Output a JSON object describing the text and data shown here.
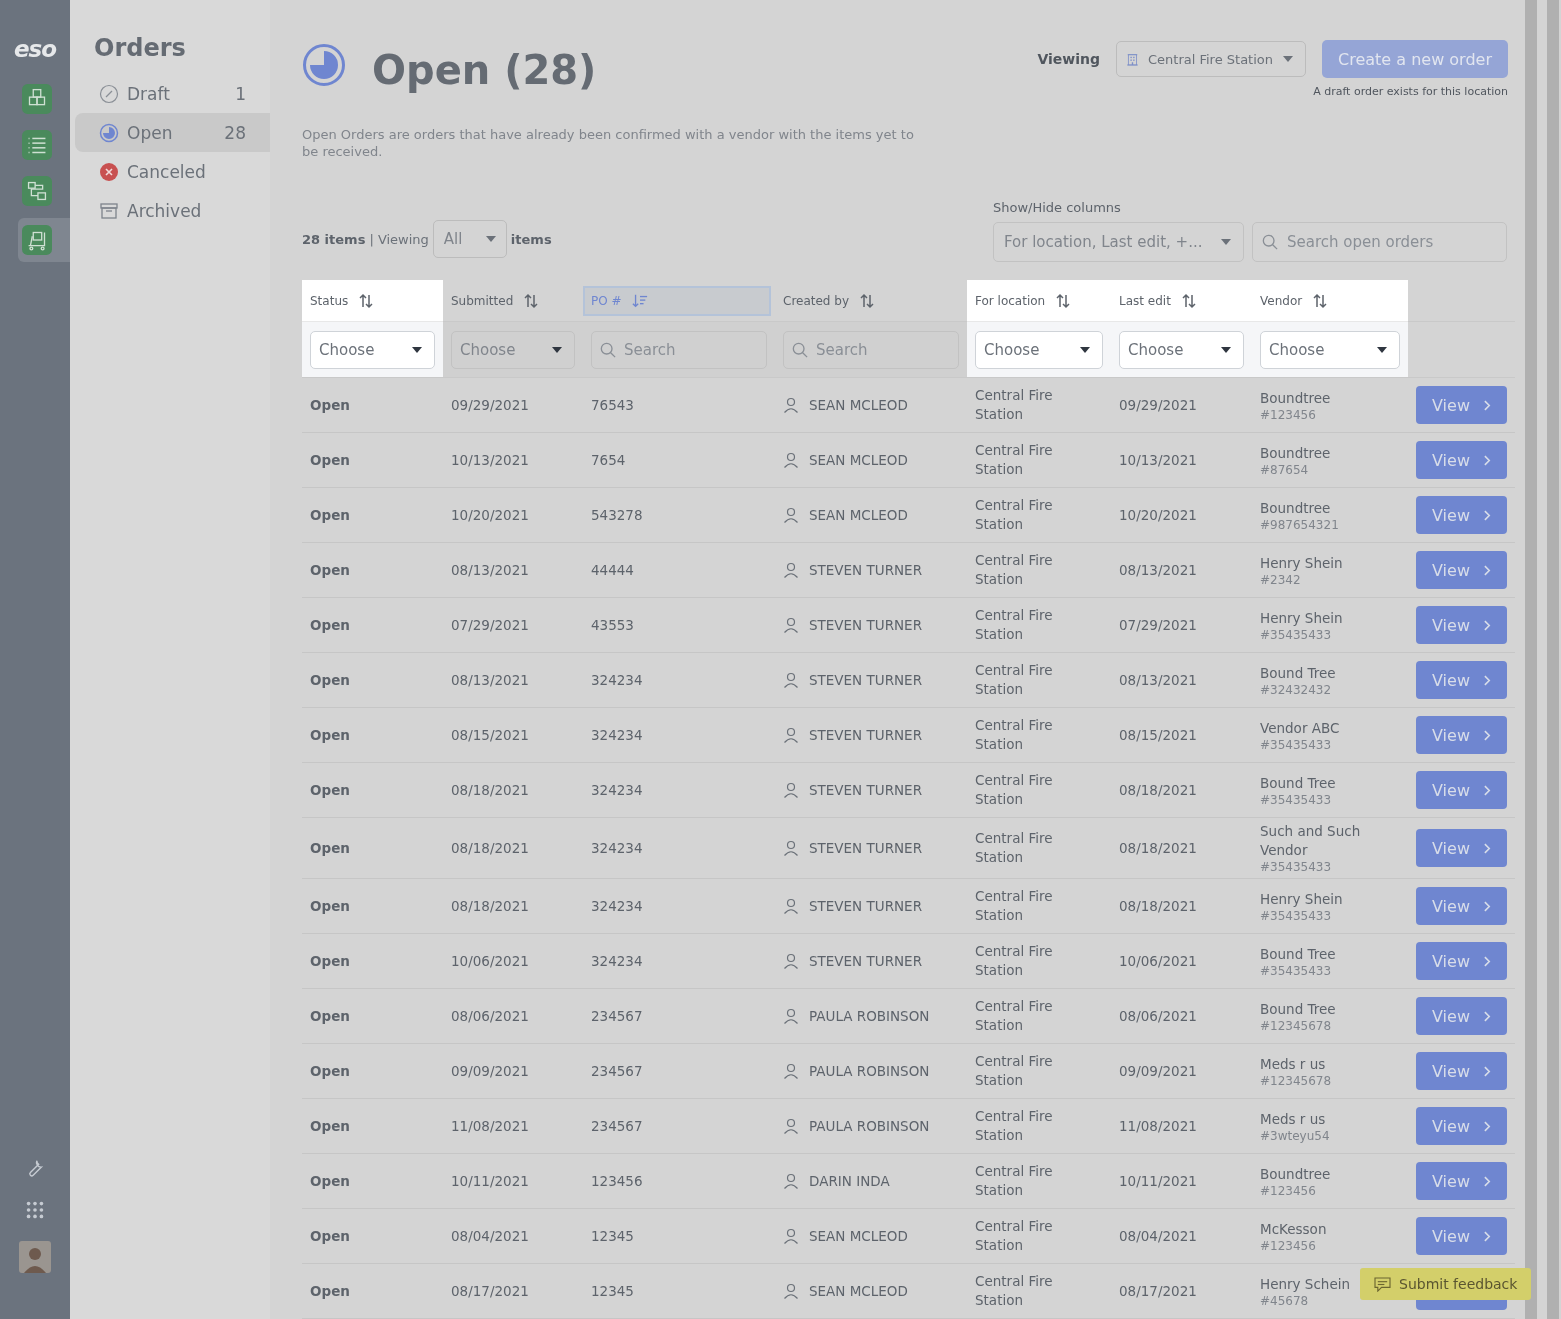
{
  "rail": {
    "logo": "eso",
    "items": [
      {
        "kind": "boxes",
        "selected": false
      },
      {
        "kind": "list",
        "selected": false
      },
      {
        "kind": "flow",
        "selected": false
      },
      {
        "kind": "cart",
        "selected": true
      }
    ]
  },
  "nav": {
    "title": "Orders",
    "items": [
      {
        "kind": "draft",
        "label": "Draft",
        "count": "1",
        "selected": false
      },
      {
        "kind": "open",
        "label": "Open",
        "count": "28",
        "selected": true
      },
      {
        "kind": "canceled",
        "label": "Canceled",
        "selected": false
      },
      {
        "kind": "archived",
        "label": "Archived",
        "selected": false
      }
    ]
  },
  "header": {
    "title": "Open (28)",
    "description": "Open Orders are orders that have already been confirmed with a vendor with the items yet to be received.",
    "viewing_label": "Viewing",
    "location": "Central Fire Station",
    "create_button": {
      "label": "Create a new order",
      "disabled": true
    },
    "note": "A draft order exists for this location"
  },
  "toolbar": {
    "count": "28 items",
    "viewing": "| Viewing",
    "page_size": "All",
    "suffix": "items",
    "columns_label": "Show/Hide columns",
    "columns_value": "For location, Last edit, +...",
    "search_placeholder": "Search open orders"
  },
  "columns": [
    {
      "label": "Status",
      "sorted": false,
      "highlighted": true,
      "filter": {
        "kind": "select",
        "placeholder": "Choose"
      }
    },
    {
      "label": "Submitted",
      "sorted": false,
      "highlighted": false,
      "filter": {
        "kind": "select",
        "placeholder": "Choose"
      }
    },
    {
      "label": "PO #",
      "sorted": true,
      "highlighted": false,
      "filter": {
        "kind": "search",
        "placeholder": "Search"
      }
    },
    {
      "label": "Created by",
      "sorted": false,
      "highlighted": false,
      "filter": {
        "kind": "search",
        "placeholder": "Search"
      }
    },
    {
      "label": "For location",
      "sorted": false,
      "highlighted": true,
      "filter": {
        "kind": "select",
        "placeholder": "Choose"
      }
    },
    {
      "label": "Last edit",
      "sorted": false,
      "highlighted": true,
      "filter": {
        "kind": "select",
        "placeholder": "Choose"
      }
    },
    {
      "label": "Vendor",
      "sorted": false,
      "highlighted": true,
      "filter": {
        "kind": "select",
        "placeholder": "Choose"
      }
    }
  ],
  "rows": [
    {
      "status": "Open",
      "submitted": "09/29/2021",
      "po": "76543",
      "created_by": "SEAN MCLEOD",
      "location": "Central Fire Station",
      "last_edit": "09/29/2021",
      "vendor": "Boundtree",
      "vendor_id": "#123456",
      "action": "View"
    },
    {
      "status": "Open",
      "submitted": "10/13/2021",
      "po": "7654",
      "created_by": "SEAN MCLEOD",
      "location": "Central Fire Station",
      "last_edit": "10/13/2021",
      "vendor": "Boundtree",
      "vendor_id": "#87654",
      "action": "View"
    },
    {
      "status": "Open",
      "submitted": "10/20/2021",
      "po": "543278",
      "created_by": "SEAN MCLEOD",
      "location": "Central Fire Station",
      "last_edit": "10/20/2021",
      "vendor": "Boundtree",
      "vendor_id": "#987654321",
      "action": "View"
    },
    {
      "status": "Open",
      "submitted": "08/13/2021",
      "po": "44444",
      "created_by": "STEVEN TURNER",
      "location": "Central Fire Station",
      "last_edit": "08/13/2021",
      "vendor": "Henry Shein",
      "vendor_id": "#2342",
      "action": "View"
    },
    {
      "status": "Open",
      "submitted": "07/29/2021",
      "po": "43553",
      "created_by": "STEVEN TURNER",
      "location": "Central Fire Station",
      "last_edit": "07/29/2021",
      "vendor": "Henry Shein",
      "vendor_id": "#35435433",
      "action": "View"
    },
    {
      "status": "Open",
      "submitted": "08/13/2021",
      "po": "324234",
      "created_by": "STEVEN TURNER",
      "location": "Central Fire Station",
      "last_edit": "08/13/2021",
      "vendor": "Bound Tree",
      "vendor_id": "#32432432",
      "action": "View"
    },
    {
      "status": "Open",
      "submitted": "08/15/2021",
      "po": "324234",
      "created_by": "STEVEN TURNER",
      "location": "Central Fire Station",
      "last_edit": "08/15/2021",
      "vendor": "Vendor ABC",
      "vendor_id": "#35435433",
      "action": "View"
    },
    {
      "status": "Open",
      "submitted": "08/18/2021",
      "po": "324234",
      "created_by": "STEVEN TURNER",
      "location": "Central Fire Station",
      "last_edit": "08/18/2021",
      "vendor": "Bound Tree",
      "vendor_id": "#35435433",
      "action": "View"
    },
    {
      "status": "Open",
      "submitted": "08/18/2021",
      "po": "324234",
      "created_by": "STEVEN TURNER",
      "location": "Central Fire Station",
      "last_edit": "08/18/2021",
      "vendor": "Such and Such Vendor",
      "vendor_id": "#35435433",
      "action": "View"
    },
    {
      "status": "Open",
      "submitted": "08/18/2021",
      "po": "324234",
      "created_by": "STEVEN TURNER",
      "location": "Central Fire Station",
      "last_edit": "08/18/2021",
      "vendor": "Henry Shein",
      "vendor_id": "#35435433",
      "action": "View"
    },
    {
      "status": "Open",
      "submitted": "10/06/2021",
      "po": "324234",
      "created_by": "STEVEN TURNER",
      "location": "Central Fire Station",
      "last_edit": "10/06/2021",
      "vendor": "Bound Tree",
      "vendor_id": "#35435433",
      "action": "View"
    },
    {
      "status": "Open",
      "submitted": "08/06/2021",
      "po": "234567",
      "created_by": "PAULA ROBINSON",
      "location": "Central Fire Station",
      "last_edit": "08/06/2021",
      "vendor": "Bound Tree",
      "vendor_id": "#12345678",
      "action": "View"
    },
    {
      "status": "Open",
      "submitted": "09/09/2021",
      "po": "234567",
      "created_by": "PAULA ROBINSON",
      "location": "Central Fire Station",
      "last_edit": "09/09/2021",
      "vendor": "Meds r us",
      "vendor_id": "#12345678",
      "action": "View"
    },
    {
      "status": "Open",
      "submitted": "11/08/2021",
      "po": "234567",
      "created_by": "PAULA ROBINSON",
      "location": "Central Fire Station",
      "last_edit": "11/08/2021",
      "vendor": "Meds r us",
      "vendor_id": "#3wteyu54",
      "action": "View"
    },
    {
      "status": "Open",
      "submitted": "10/11/2021",
      "po": "123456",
      "created_by": "DARIN INDA",
      "location": "Central Fire Station",
      "last_edit": "10/11/2021",
      "vendor": "Boundtree",
      "vendor_id": "#123456",
      "action": "View"
    },
    {
      "status": "Open",
      "submitted": "08/04/2021",
      "po": "12345",
      "created_by": "SEAN MCLEOD",
      "location": "Central Fire Station",
      "last_edit": "08/04/2021",
      "vendor": "McKesson",
      "vendor_id": "#123456",
      "action": "View"
    },
    {
      "status": "Open",
      "submitted": "08/17/2021",
      "po": "12345",
      "created_by": "SEAN MCLEOD",
      "location": "Central Fire Station",
      "last_edit": "08/17/2021",
      "vendor": "Henry Schein",
      "vendor_id": "#45678"
    }
  ],
  "feedback": {
    "label": "Submit feedback"
  }
}
